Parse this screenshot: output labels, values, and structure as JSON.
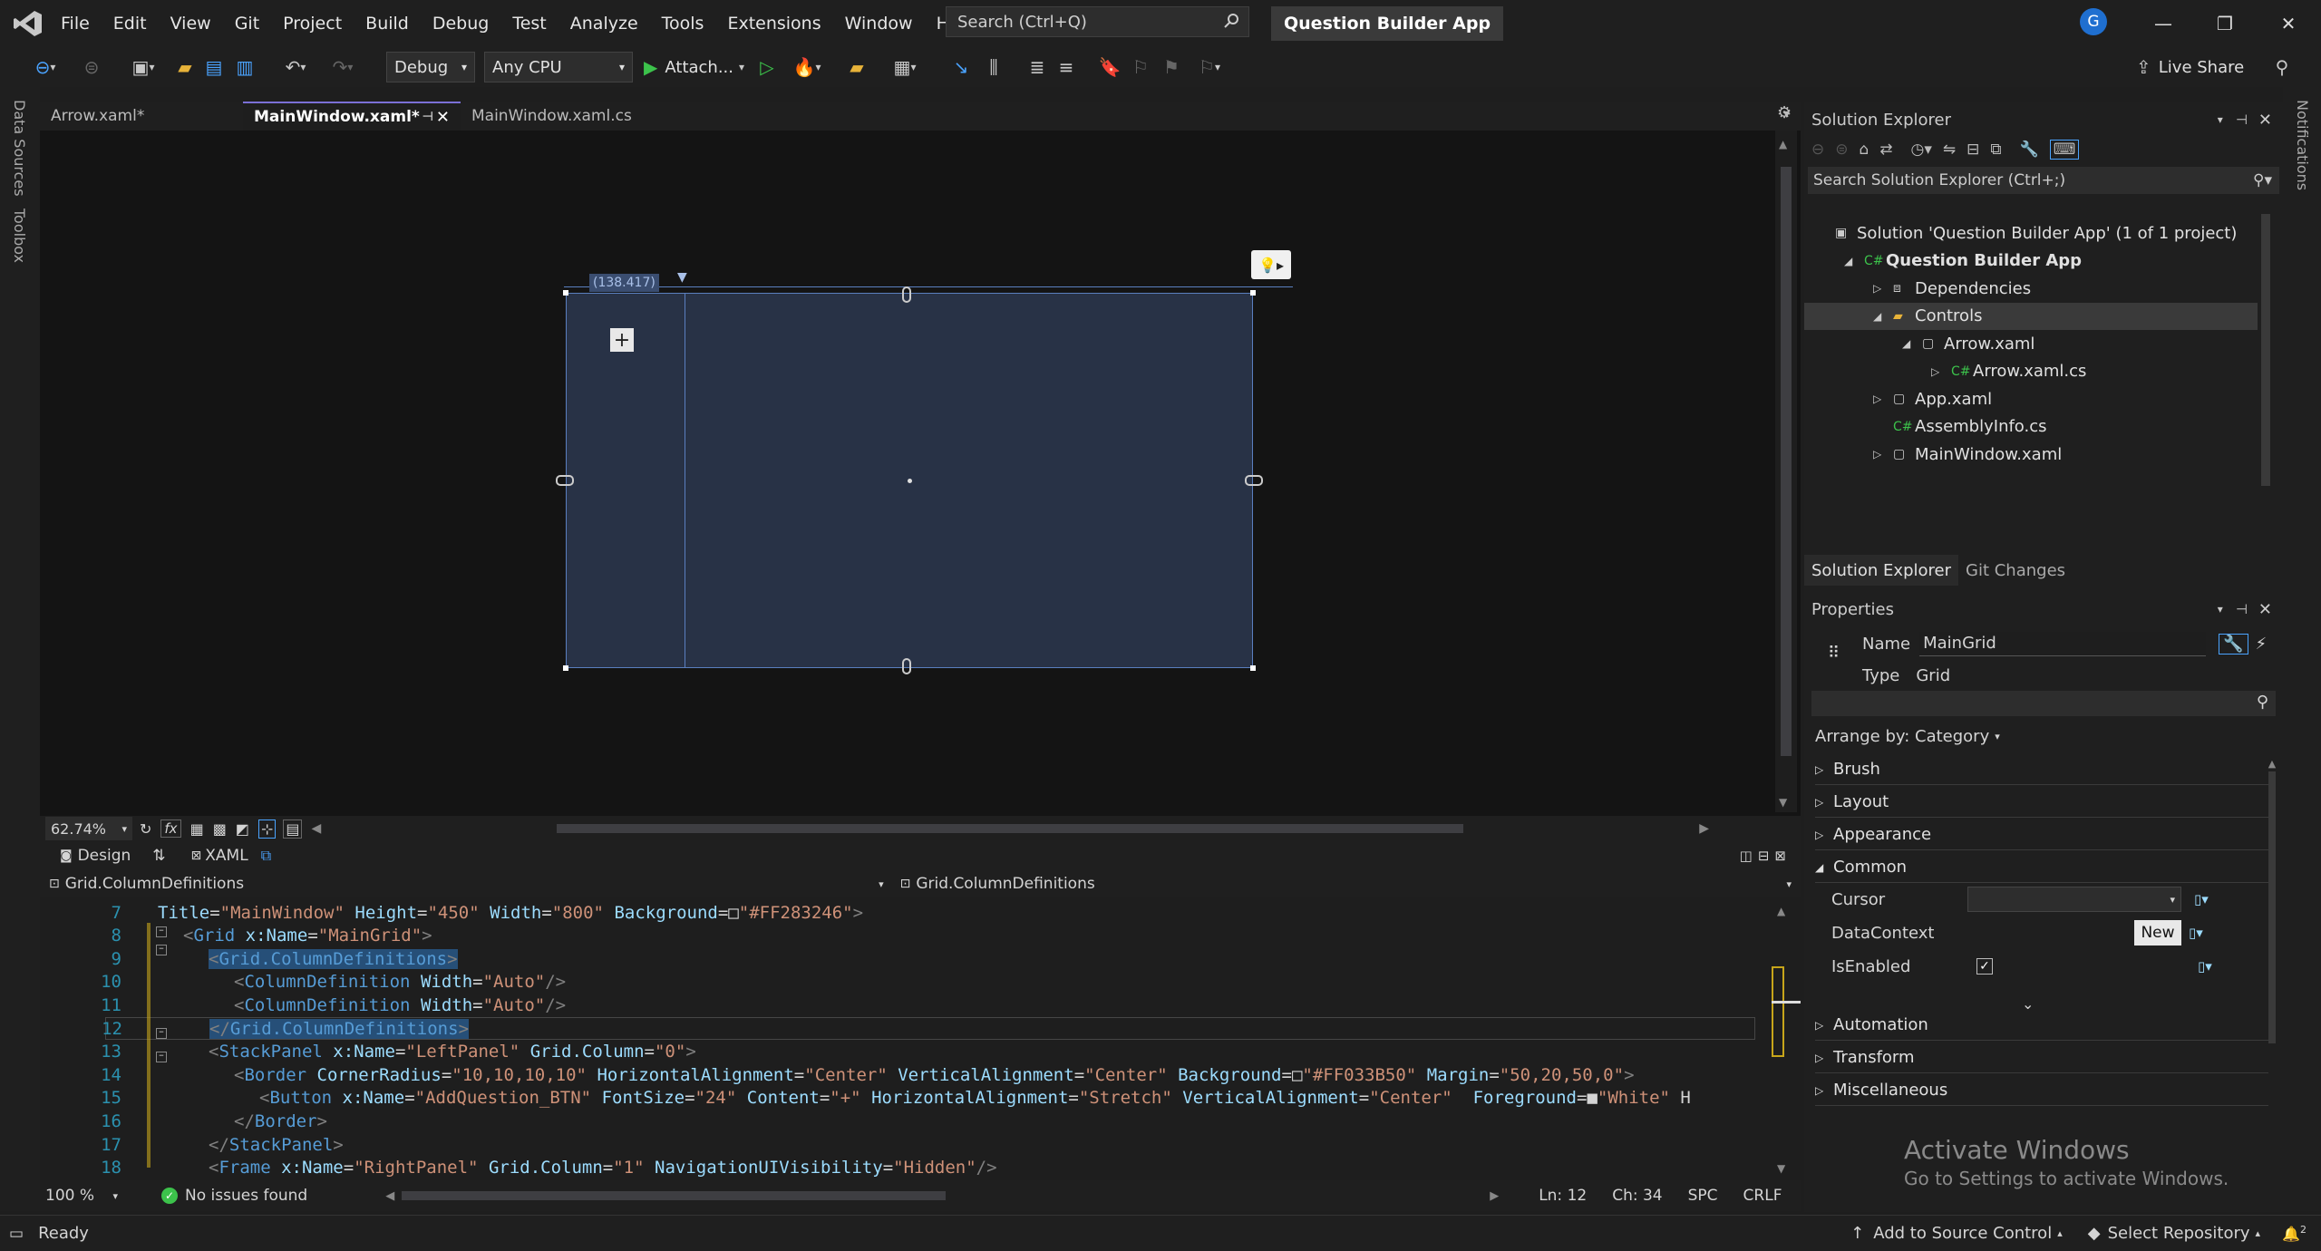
{
  "titlebar": {
    "menus": [
      "File",
      "Edit",
      "View",
      "Git",
      "Project",
      "Build",
      "Debug",
      "Test",
      "Analyze",
      "Tools",
      "Extensions",
      "Window",
      "Help"
    ],
    "search_placeholder": "Search (Ctrl+Q)",
    "app_title": "Question Builder App",
    "avatar_letter": "G"
  },
  "toolbar": {
    "config": "Debug",
    "platform": "Any CPU",
    "attach_label": "Attach...",
    "live_share": "Live Share"
  },
  "left_strip": [
    "Data Sources",
    "Toolbox"
  ],
  "right_strip": [
    "Notifications"
  ],
  "tabs": [
    {
      "label": "Arrow.xaml*",
      "active": false
    },
    {
      "label": "MainWindow.xaml*",
      "active": true
    },
    {
      "label": "MainWindow.xaml.cs",
      "active": false
    }
  ],
  "designer": {
    "column_width_label": "(138.417)",
    "zoom": "62.74%"
  },
  "view_switcher": {
    "design": "Design",
    "xaml": "XAML"
  },
  "breadcrumb": {
    "left": "Grid.ColumnDefinitions",
    "right": "Grid.ColumnDefinitions"
  },
  "code": [
    {
      "ln": "7",
      "indent": 0,
      "text": "Title=\"MainWindow\" Height=\"450\" Width=\"800\" Background=□\"#FF283246\">"
    },
    {
      "ln": "8",
      "indent": 1,
      "text": "<Grid x:Name=\"MainGrid\">"
    },
    {
      "ln": "9",
      "indent": 2,
      "text": "<Grid.ColumnDefinitions>"
    },
    {
      "ln": "10",
      "indent": 3,
      "text": "<ColumnDefinition Width=\"Auto\"/>"
    },
    {
      "ln": "11",
      "indent": 3,
      "text": "<ColumnDefinition Width=\"Auto\"/>"
    },
    {
      "ln": "12",
      "indent": 2,
      "text": "</Grid.ColumnDefinitions>"
    },
    {
      "ln": "13",
      "indent": 2,
      "text": "<StackPanel x:Name=\"LeftPanel\" Grid.Column=\"0\">"
    },
    {
      "ln": "14",
      "indent": 3,
      "text": "<Border CornerRadius=\"10,10,10,10\" HorizontalAlignment=\"Center\" VerticalAlignment=\"Center\" Background=□\"#FF033B50\" Margin=\"50,20,50,0\">"
    },
    {
      "ln": "15",
      "indent": 4,
      "text": "<Button x:Name=\"AddQuestion_BTN\" FontSize=\"24\" Content=\"+\" HorizontalAlignment=\"Stretch\" VerticalAlignment=\"Center\"  Foreground=■\"White\" H"
    },
    {
      "ln": "16",
      "indent": 3,
      "text": "</Border>"
    },
    {
      "ln": "17",
      "indent": 2,
      "text": "</StackPanel>"
    },
    {
      "ln": "18",
      "indent": 2,
      "text": "<Frame x:Name=\"RightPanel\" Grid.Column=\"1\" NavigationUIVisibility=\"Hidden\"/>"
    }
  ],
  "editor_status": {
    "zoom": "100 %",
    "issues": "No issues found",
    "line": "Ln: 12",
    "col": "Ch: 34",
    "spc": "SPC",
    "eol": "CRLF"
  },
  "solution_explorer": {
    "title": "Solution Explorer",
    "search_placeholder": "Search Solution Explorer (Ctrl+;)",
    "items": [
      {
        "label": "Solution 'Question Builder App' (1 of 1 project)",
        "icon": "solution-icon",
        "depth": 0
      },
      {
        "label": "Question Builder App",
        "icon": "csproj-icon",
        "depth": 1,
        "bold": true
      },
      {
        "label": "Dependencies",
        "icon": "dependencies-icon",
        "depth": 2
      },
      {
        "label": "Controls",
        "icon": "folder-icon",
        "depth": 2
      },
      {
        "label": "Arrow.xaml",
        "icon": "xaml-file-icon",
        "depth": 3
      },
      {
        "label": "Arrow.xaml.cs",
        "icon": "csharp-file-icon",
        "depth": 4
      },
      {
        "label": "App.xaml",
        "icon": "xaml-file-icon",
        "depth": 2
      },
      {
        "label": "AssemblyInfo.cs",
        "icon": "csharp-file-icon",
        "depth": 2
      },
      {
        "label": "MainWindow.xaml",
        "icon": "xaml-file-icon",
        "depth": 2
      }
    ],
    "bottom_tabs": [
      "Solution Explorer",
      "Git Changes"
    ]
  },
  "properties": {
    "title": "Properties",
    "name_label": "Name",
    "name_value": "MainGrid",
    "type_label": "Type",
    "type_value": "Grid",
    "arrange": "Arrange by: Category",
    "categories_top": [
      "Brush",
      "Layout",
      "Appearance",
      "Common"
    ],
    "common_props": [
      {
        "label": "Cursor"
      },
      {
        "label": "DataContext",
        "button": "New"
      },
      {
        "label": "IsEnabled",
        "checked": true
      }
    ],
    "categories_bottom": [
      "Automation",
      "Transform",
      "Miscellaneous"
    ],
    "watermark_title": "Activate Windows",
    "watermark_sub": "Go to Settings to activate Windows."
  },
  "statusbar": {
    "ready": "Ready",
    "source_control": "Add to Source Control",
    "repo": "Select Repository",
    "notification_count": "2"
  }
}
